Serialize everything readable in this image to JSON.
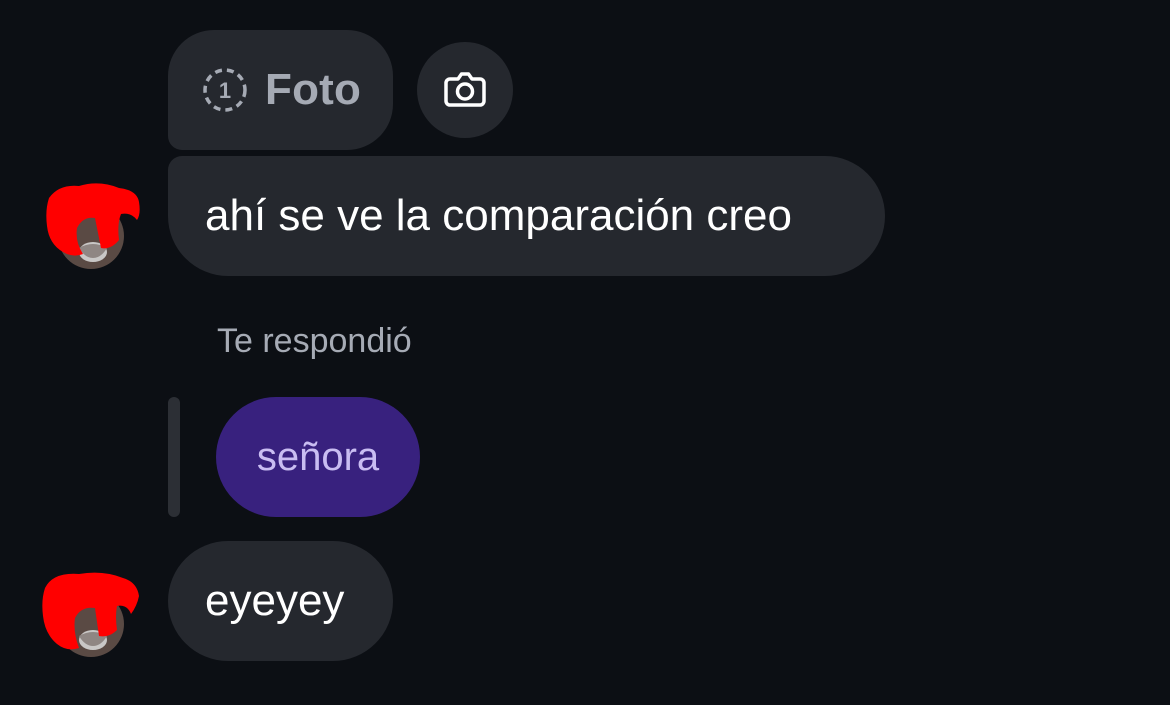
{
  "thread": {
    "photo_message": {
      "label": "Foto",
      "view_once_count": "1",
      "icon": "view-once-icon"
    },
    "camera_button": {
      "icon": "camera-icon"
    },
    "message_1": {
      "text": "ahí se ve la comparación creo"
    },
    "reply": {
      "caption": "Te respondió",
      "quoted_text": "señora"
    },
    "message_2": {
      "text": "eyeyey"
    }
  },
  "colors": {
    "background": "#0c0f14",
    "incoming_bubble": "#25282e",
    "quoted_bubble": "#38217e",
    "quoted_text": "#c9bdf2",
    "muted_text": "#a6abb5",
    "redaction": "#ff0000"
  }
}
